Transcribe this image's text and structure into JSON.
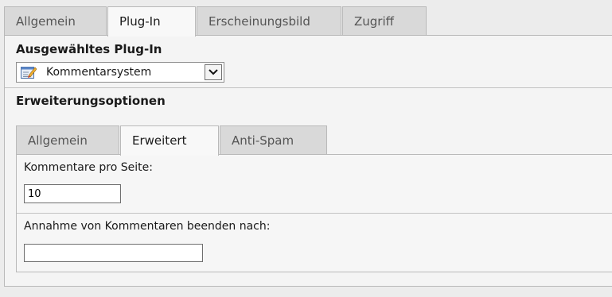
{
  "top_tabs": [
    "Allgemein",
    "Plug-In",
    "Erscheinungsbild",
    "Zugriff"
  ],
  "plugin_section": {
    "title": "Ausgewähltes Plug-In",
    "selected_value": "Kommentarsystem",
    "icon": "plugin-edit-icon"
  },
  "extension_section": {
    "title": "Erweiterungsoptionen",
    "tabs": [
      "Allgemein",
      "Erweitert",
      "Anti-Spam"
    ],
    "active_tab": "Erweitert",
    "fields": {
      "comments_per_page": {
        "label": "Kommentare pro Seite:",
        "value": "10"
      },
      "close_comments_after": {
        "label": "Annahme von Kommentaren beenden nach:",
        "value": ""
      }
    }
  }
}
